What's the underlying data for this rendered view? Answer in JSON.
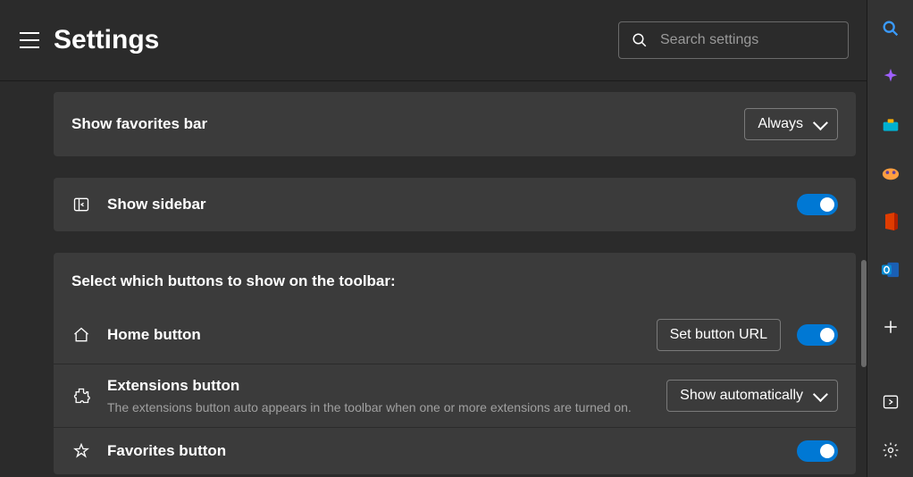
{
  "header": {
    "title": "Settings",
    "search_placeholder": "Search settings"
  },
  "rows": {
    "favorites_bar": {
      "label": "Show favorites bar",
      "dropdown_value": "Always"
    },
    "sidebar": {
      "label": "Show sidebar",
      "toggle_on": true
    },
    "section_header": "Select which buttons to show on the toolbar:",
    "home": {
      "label": "Home button",
      "button_label": "Set button URL",
      "toggle_on": true
    },
    "extensions": {
      "label": "Extensions button",
      "dropdown_value": "Show automatically",
      "description": "The extensions button auto appears in the toolbar when one or more extensions are turned on."
    },
    "favorites_button": {
      "label": "Favorites button",
      "toggle_on": true
    }
  },
  "side_panel": {
    "items": [
      "search",
      "copilot",
      "tools",
      "games",
      "office",
      "outlook",
      "add"
    ],
    "bottom": [
      "collapse",
      "settings"
    ]
  }
}
